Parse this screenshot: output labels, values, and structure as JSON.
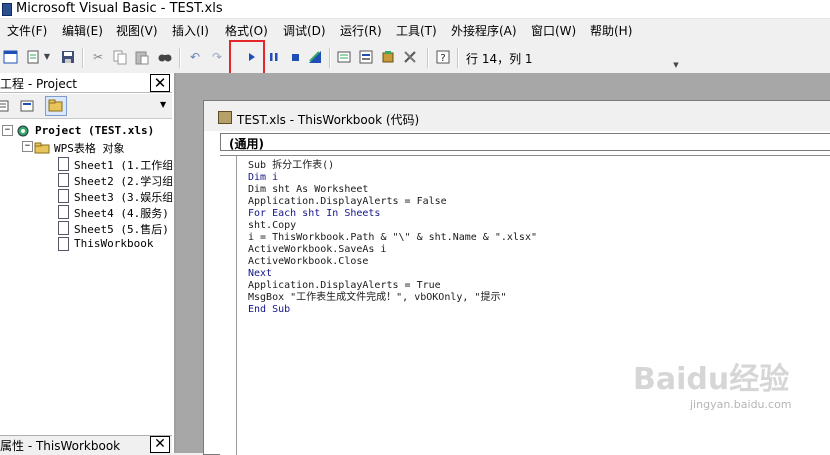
{
  "window": {
    "title": "Microsoft Visual Basic - TEST.xls"
  },
  "menu": [
    "文件(F)",
    "编辑(E)",
    "视图(V)",
    "插入(I)",
    "格式(O)",
    "调试(D)",
    "运行(R)",
    "工具(T)",
    "外接程序(A)",
    "窗口(W)",
    "帮助(H)"
  ],
  "toolbar": {
    "position": "行 14，列 1"
  },
  "project": {
    "title": "工程 - Project",
    "root": "Project (TEST.xls)",
    "folder": "WPS表格 对象",
    "items": [
      "Sheet1 (1.工作组",
      "Sheet2 (2.学习组",
      "Sheet3 (3.娱乐组",
      "Sheet4 (4.服务)",
      "Sheet5 (5.售后)",
      "ThisWorkbook"
    ]
  },
  "properties": {
    "title": "属性 - ThisWorkbook"
  },
  "code_window": {
    "title": "TEST.xls - ThisWorkbook (代码)",
    "object": "(通用)",
    "lines": [
      "Sub 拆分工作表()",
      "Dim i",
      "Dim sht As Worksheet",
      "Application.DisplayAlerts = False",
      "For Each sht In Sheets",
      "sht.Copy",
      "i = ThisWorkbook.Path & \"\\\" & sht.Name & \".xlsx\"",
      "ActiveWorkbook.SaveAs i",
      "ActiveWorkbook.Close",
      "Next",
      "Application.DisplayAlerts = True",
      "MsgBox \"工作表生成文件完成！\", vbOKOnly, \"提示\"",
      "End Sub"
    ]
  },
  "watermark": {
    "brand": "Baidu经验",
    "url": "jingyan.baidu.com"
  },
  "colors": {
    "highlight": "#e3262a",
    "mdi_background": "#a7a7a7",
    "run_icon": "#1f4fb5",
    "code_keyword": "#14148c"
  },
  "icons": [
    "view-excel-icon",
    "insert-module-icon",
    "save-icon",
    "cut-icon",
    "copy-icon",
    "paste-icon",
    "find-icon",
    "undo-icon",
    "redo-icon",
    "run-icon",
    "pause-icon",
    "stop-icon",
    "design-mode-icon",
    "project-explorer-icon",
    "properties-icon",
    "object-browser-icon",
    "toolbox-icon",
    "help-icon"
  ]
}
